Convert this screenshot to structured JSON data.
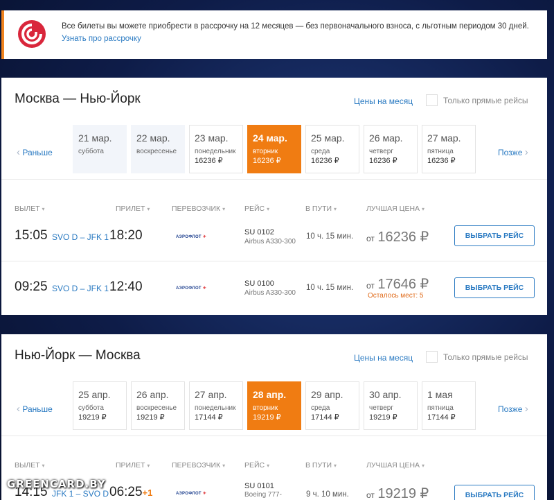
{
  "banner": {
    "text": "Все билеты вы можете приобрести в рассрочку на 12 месяцев — без первоначального взноса, с льготным периодом 30 дней.",
    "link": "Узнать про рассрочку"
  },
  "common": {
    "month_prices": "Цены на месяц",
    "direct_only": "Только прямые рейсы",
    "prev": "Раньше",
    "next": "Позже",
    "headers": {
      "depart": "ВЫЛЕТ",
      "arrive": "ПРИЛЕТ",
      "carrier": "ПЕРЕВОЗЧИК",
      "flight": "РЕЙС",
      "duration": "В ПУТИ",
      "best_price": "ЛУЧШАЯ ЦЕНА"
    },
    "select_button": "ВЫБРАТЬ РЕЙС",
    "from": "от",
    "airline_name": "АЭРОФЛОТ"
  },
  "outbound": {
    "title": "Москва — Нью-Йорк",
    "dates": [
      {
        "date": "21 мар.",
        "weekday": "суббота",
        "price": ""
      },
      {
        "date": "22 мар.",
        "weekday": "воскресенье",
        "price": ""
      },
      {
        "date": "23 мар.",
        "weekday": "понедельник",
        "price": "16236 ₽"
      },
      {
        "date": "24 мар.",
        "weekday": "вторник",
        "price": "16236 ₽"
      },
      {
        "date": "25 мар.",
        "weekday": "среда",
        "price": "16236 ₽"
      },
      {
        "date": "26 мар.",
        "weekday": "четверг",
        "price": "16236 ₽"
      },
      {
        "date": "27 мар.",
        "weekday": "пятница",
        "price": "16236 ₽"
      }
    ],
    "flights": [
      {
        "dep": "15:05",
        "route": "SVO D – JFK 1",
        "arr": "18:20",
        "arr_extra": "",
        "num": "SU 0102",
        "aircraft": "Airbus A330-300",
        "duration": "10 ч. 15 мин.",
        "price": "16236 ₽",
        "seats": ""
      },
      {
        "dep": "09:25",
        "route": "SVO D – JFK 1",
        "arr": "12:40",
        "arr_extra": "",
        "num": "SU 0100",
        "aircraft": "Airbus A330-300",
        "duration": "10 ч. 15 мин.",
        "price": "17646 ₽",
        "seats": "Осталось мест: 5"
      }
    ]
  },
  "inbound": {
    "title": "Нью-Йорк — Москва",
    "dates": [
      {
        "date": "25 апр.",
        "weekday": "суббота",
        "price": "19219 ₽"
      },
      {
        "date": "26 апр.",
        "weekday": "воскресенье",
        "price": "19219 ₽"
      },
      {
        "date": "27 апр.",
        "weekday": "понедельник",
        "price": "17144 ₽"
      },
      {
        "date": "28 апр.",
        "weekday": "вторник",
        "price": "19219 ₽"
      },
      {
        "date": "29 апр.",
        "weekday": "среда",
        "price": "17144 ₽"
      },
      {
        "date": "30 апр.",
        "weekday": "четверг",
        "price": "19219 ₽"
      },
      {
        "date": "1 мая",
        "weekday": "пятница",
        "price": "17144 ₽"
      }
    ],
    "flights": [
      {
        "dep": "14:15",
        "route": "JFK 1 – SVO D",
        "arr": "06:25",
        "arr_extra": "+1",
        "num": "SU 0101",
        "aircraft": "Boeing 777-",
        "duration": "9 ч. 10 мин.",
        "price": "19219 ₽",
        "seats": ""
      }
    ]
  },
  "watermark": "GREENCARD.BY",
  "colors": {
    "accent": "#f07c12",
    "link": "#2a7ac2",
    "brand_red": "#d9263b"
  }
}
